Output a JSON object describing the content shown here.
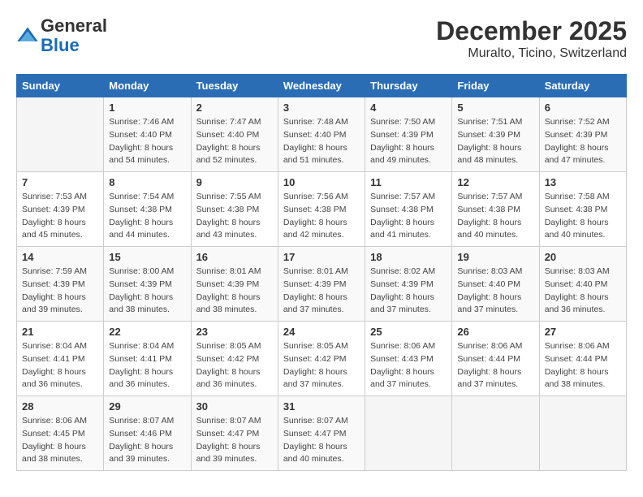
{
  "header": {
    "logo_line1": "General",
    "logo_line2": "Blue",
    "title": "December 2025",
    "subtitle": "Muralto, Ticino, Switzerland"
  },
  "calendar": {
    "days_of_week": [
      "Sunday",
      "Monday",
      "Tuesday",
      "Wednesday",
      "Thursday",
      "Friday",
      "Saturday"
    ],
    "weeks": [
      [
        {
          "day": "",
          "info": ""
        },
        {
          "day": "1",
          "info": "Sunrise: 7:46 AM\nSunset: 4:40 PM\nDaylight: 8 hours\nand 54 minutes."
        },
        {
          "day": "2",
          "info": "Sunrise: 7:47 AM\nSunset: 4:40 PM\nDaylight: 8 hours\nand 52 minutes."
        },
        {
          "day": "3",
          "info": "Sunrise: 7:48 AM\nSunset: 4:40 PM\nDaylight: 8 hours\nand 51 minutes."
        },
        {
          "day": "4",
          "info": "Sunrise: 7:50 AM\nSunset: 4:39 PM\nDaylight: 8 hours\nand 49 minutes."
        },
        {
          "day": "5",
          "info": "Sunrise: 7:51 AM\nSunset: 4:39 PM\nDaylight: 8 hours\nand 48 minutes."
        },
        {
          "day": "6",
          "info": "Sunrise: 7:52 AM\nSunset: 4:39 PM\nDaylight: 8 hours\nand 47 minutes."
        }
      ],
      [
        {
          "day": "7",
          "info": "Sunrise: 7:53 AM\nSunset: 4:39 PM\nDaylight: 8 hours\nand 45 minutes."
        },
        {
          "day": "8",
          "info": "Sunrise: 7:54 AM\nSunset: 4:38 PM\nDaylight: 8 hours\nand 44 minutes."
        },
        {
          "day": "9",
          "info": "Sunrise: 7:55 AM\nSunset: 4:38 PM\nDaylight: 8 hours\nand 43 minutes."
        },
        {
          "day": "10",
          "info": "Sunrise: 7:56 AM\nSunset: 4:38 PM\nDaylight: 8 hours\nand 42 minutes."
        },
        {
          "day": "11",
          "info": "Sunrise: 7:57 AM\nSunset: 4:38 PM\nDaylight: 8 hours\nand 41 minutes."
        },
        {
          "day": "12",
          "info": "Sunrise: 7:57 AM\nSunset: 4:38 PM\nDaylight: 8 hours\nand 40 minutes."
        },
        {
          "day": "13",
          "info": "Sunrise: 7:58 AM\nSunset: 4:38 PM\nDaylight: 8 hours\nand 40 minutes."
        }
      ],
      [
        {
          "day": "14",
          "info": "Sunrise: 7:59 AM\nSunset: 4:39 PM\nDaylight: 8 hours\nand 39 minutes."
        },
        {
          "day": "15",
          "info": "Sunrise: 8:00 AM\nSunset: 4:39 PM\nDaylight: 8 hours\nand 38 minutes."
        },
        {
          "day": "16",
          "info": "Sunrise: 8:01 AM\nSunset: 4:39 PM\nDaylight: 8 hours\nand 38 minutes."
        },
        {
          "day": "17",
          "info": "Sunrise: 8:01 AM\nSunset: 4:39 PM\nDaylight: 8 hours\nand 37 minutes."
        },
        {
          "day": "18",
          "info": "Sunrise: 8:02 AM\nSunset: 4:39 PM\nDaylight: 8 hours\nand 37 minutes."
        },
        {
          "day": "19",
          "info": "Sunrise: 8:03 AM\nSunset: 4:40 PM\nDaylight: 8 hours\nand 37 minutes."
        },
        {
          "day": "20",
          "info": "Sunrise: 8:03 AM\nSunset: 4:40 PM\nDaylight: 8 hours\nand 36 minutes."
        }
      ],
      [
        {
          "day": "21",
          "info": "Sunrise: 8:04 AM\nSunset: 4:41 PM\nDaylight: 8 hours\nand 36 minutes."
        },
        {
          "day": "22",
          "info": "Sunrise: 8:04 AM\nSunset: 4:41 PM\nDaylight: 8 hours\nand 36 minutes."
        },
        {
          "day": "23",
          "info": "Sunrise: 8:05 AM\nSunset: 4:42 PM\nDaylight: 8 hours\nand 36 minutes."
        },
        {
          "day": "24",
          "info": "Sunrise: 8:05 AM\nSunset: 4:42 PM\nDaylight: 8 hours\nand 37 minutes."
        },
        {
          "day": "25",
          "info": "Sunrise: 8:06 AM\nSunset: 4:43 PM\nDaylight: 8 hours\nand 37 minutes."
        },
        {
          "day": "26",
          "info": "Sunrise: 8:06 AM\nSunset: 4:44 PM\nDaylight: 8 hours\nand 37 minutes."
        },
        {
          "day": "27",
          "info": "Sunrise: 8:06 AM\nSunset: 4:44 PM\nDaylight: 8 hours\nand 38 minutes."
        }
      ],
      [
        {
          "day": "28",
          "info": "Sunrise: 8:06 AM\nSunset: 4:45 PM\nDaylight: 8 hours\nand 38 minutes."
        },
        {
          "day": "29",
          "info": "Sunrise: 8:07 AM\nSunset: 4:46 PM\nDaylight: 8 hours\nand 39 minutes."
        },
        {
          "day": "30",
          "info": "Sunrise: 8:07 AM\nSunset: 4:47 PM\nDaylight: 8 hours\nand 39 minutes."
        },
        {
          "day": "31",
          "info": "Sunrise: 8:07 AM\nSunset: 4:47 PM\nDaylight: 8 hours\nand 40 minutes."
        },
        {
          "day": "",
          "info": ""
        },
        {
          "day": "",
          "info": ""
        },
        {
          "day": "",
          "info": ""
        }
      ]
    ]
  }
}
